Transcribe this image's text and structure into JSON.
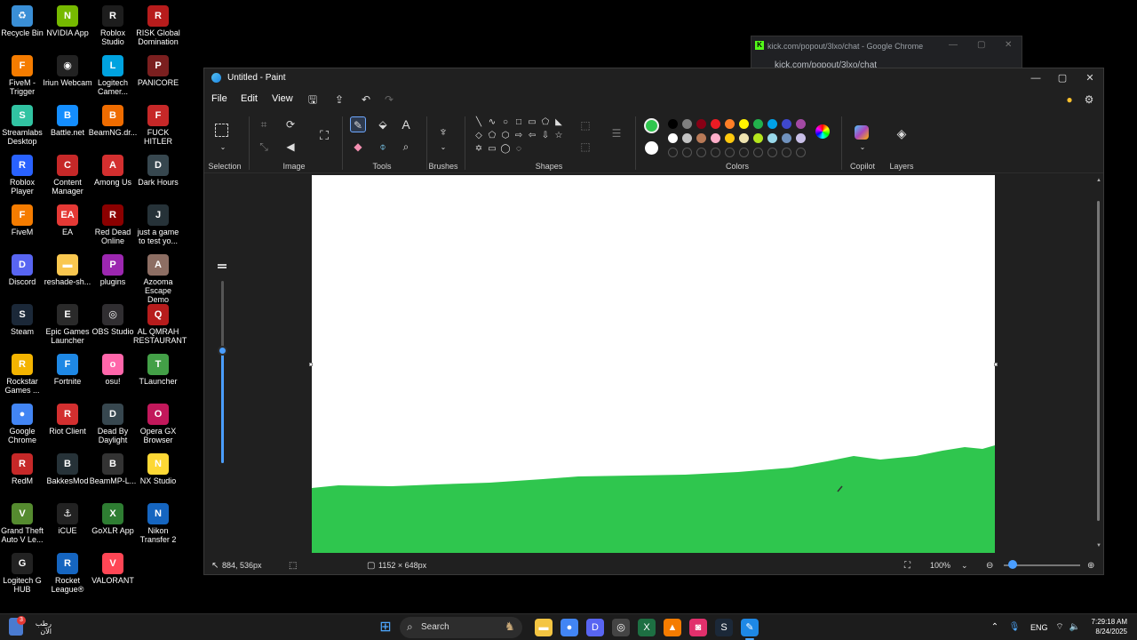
{
  "desktop": {
    "icons": [
      {
        "label": "Recycle Bin",
        "color": "#3a8fd6",
        "glyph": "♻"
      },
      {
        "label": "NVIDIA App",
        "color": "#76b900",
        "glyph": "N"
      },
      {
        "label": "Roblox Studio",
        "color": "#1d1d1d",
        "glyph": "R"
      },
      {
        "label": "RISK Global Domination",
        "color": "#b71c1c",
        "glyph": "R"
      },
      {
        "label": "FiveM - Trigger",
        "color": "#f57c00",
        "glyph": "F"
      },
      {
        "label": "Iriun Webcam",
        "color": "#222",
        "glyph": "◉"
      },
      {
        "label": "Logitech Camer...",
        "color": "#00a3e0",
        "glyph": "L"
      },
      {
        "label": "PANICORE",
        "color": "#7b1f1f",
        "glyph": "P"
      },
      {
        "label": "Streamlabs Desktop",
        "color": "#31c3a2",
        "glyph": "S"
      },
      {
        "label": "Battle.net",
        "color": "#148eff",
        "glyph": "B"
      },
      {
        "label": "BeamNG.dr...",
        "color": "#ef6c00",
        "glyph": "B"
      },
      {
        "label": "FUCK HITLER",
        "color": "#c62828",
        "glyph": "F"
      },
      {
        "label": "Roblox Player",
        "color": "#2962ff",
        "glyph": "R"
      },
      {
        "label": "Content Manager",
        "color": "#c62828",
        "glyph": "C"
      },
      {
        "label": "Among Us",
        "color": "#d32f2f",
        "glyph": "A"
      },
      {
        "label": "Dark Hours",
        "color": "#37474f",
        "glyph": "D"
      },
      {
        "label": "FiveM",
        "color": "#f57c00",
        "glyph": "F"
      },
      {
        "label": "EA",
        "color": "#e53935",
        "glyph": "EA"
      },
      {
        "label": "Red Dead Online",
        "color": "#8b0000",
        "glyph": "R"
      },
      {
        "label": "just a game to test yo...",
        "color": "#263238",
        "glyph": "J"
      },
      {
        "label": "Discord",
        "color": "#5865f2",
        "glyph": "D"
      },
      {
        "label": "reshade-sh...",
        "color": "#f9c74f",
        "glyph": "▬"
      },
      {
        "label": "plugins",
        "color": "#9c27b0",
        "glyph": "P"
      },
      {
        "label": "Azooma Escape Demo",
        "color": "#8d6e63",
        "glyph": "A"
      },
      {
        "label": "Steam",
        "color": "#1b2838",
        "glyph": "S"
      },
      {
        "label": "Epic Games Launcher",
        "color": "#2a2a2a",
        "glyph": "E"
      },
      {
        "label": "OBS Studio",
        "color": "#302e31",
        "glyph": "◎"
      },
      {
        "label": "AL QMRAH RESTAURANT",
        "color": "#b71c1c",
        "glyph": "Q"
      },
      {
        "label": "Rockstar Games ...",
        "color": "#f4b400",
        "glyph": "R"
      },
      {
        "label": "Fortnite",
        "color": "#1e88e5",
        "glyph": "F"
      },
      {
        "label": "osu!",
        "color": "#ff66aa",
        "glyph": "o"
      },
      {
        "label": "TLauncher",
        "color": "#43a047",
        "glyph": "T"
      },
      {
        "label": "Google Chrome",
        "color": "#4285f4",
        "glyph": "●"
      },
      {
        "label": "Riot Client",
        "color": "#d32f2f",
        "glyph": "R"
      },
      {
        "label": "Dead By Daylight",
        "color": "#37474f",
        "glyph": "D"
      },
      {
        "label": "Opera GX Browser",
        "color": "#c2185b",
        "glyph": "O"
      },
      {
        "label": "RedM",
        "color": "#c62828",
        "glyph": "R"
      },
      {
        "label": "BakkesMod",
        "color": "#263238",
        "glyph": "B"
      },
      {
        "label": "BeamMP-L...",
        "color": "#333",
        "glyph": "B"
      },
      {
        "label": "NX Studio",
        "color": "#fdd835",
        "glyph": "N"
      },
      {
        "label": "Grand Theft Auto V Le...",
        "color": "#558b2f",
        "glyph": "V"
      },
      {
        "label": "iCUE",
        "color": "#222",
        "glyph": "⚓"
      },
      {
        "label": "GoXLR App",
        "color": "#2e7d32",
        "glyph": "X"
      },
      {
        "label": "Nikon Transfer 2",
        "color": "#1565c0",
        "glyph": "N"
      },
      {
        "label": "Logitech G HUB",
        "color": "#222",
        "glyph": "G"
      },
      {
        "label": "Rocket League®",
        "color": "#1565c0",
        "glyph": "R"
      },
      {
        "label": "VALORANT",
        "color": "#ff4655",
        "glyph": "V"
      }
    ]
  },
  "chrome_window": {
    "title": "kick.com/popout/3lxo/chat - Google Chrome",
    "url": "kick.com/popout/3lxo/chat",
    "favicon": "K",
    "controls": {
      "minimize": "—",
      "maximize": "▢",
      "close": "✕"
    }
  },
  "paint": {
    "title": "Untitled - Paint",
    "window_controls": {
      "minimize": "—",
      "maximize": "▢",
      "close": "✕"
    },
    "menus": [
      "File",
      "Edit",
      "View"
    ],
    "groups": {
      "selection": "Selection",
      "image": "Image",
      "tools": "Tools",
      "brushes": "Brushes",
      "shapes": "Shapes",
      "colors": "Colors",
      "copilot": "Copilot",
      "layers": "Layers"
    },
    "primary_color": "#2fc64e",
    "secondary_color": "#ffffff",
    "palette_row1": [
      "#000000",
      "#7f7f7f",
      "#880015",
      "#ed1c24",
      "#ff7f27",
      "#fff200",
      "#22b14c",
      "#00a2e8",
      "#3f48cc",
      "#a349a4"
    ],
    "palette_row2": [
      "#ffffff",
      "#c3c3c3",
      "#b97a57",
      "#ffaec9",
      "#ffc90e",
      "#efe4b0",
      "#b5e61d",
      "#99d9ea",
      "#7092be",
      "#c8bfe7"
    ],
    "shape_glyphs": [
      "╲",
      "∿",
      "○",
      "□",
      "▭",
      "⬠",
      "◣",
      "◇",
      "⬠",
      "⬡",
      "⇨",
      "⇦",
      "⇩",
      "☆",
      "✡",
      "▭",
      "◯",
      "◌"
    ],
    "brush_size_fraction": 0.62,
    "fill_color": "#2fc64e",
    "status": {
      "cursor": "884, 536px",
      "canvas_size": "1152 × 648px",
      "zoom": "100%",
      "zoom_level_fraction": 0.12
    }
  },
  "taskbar": {
    "weather_text": "رطب الآن",
    "search": "Search",
    "language": "ENG",
    "time": "7:29:18 AM",
    "date": "8/24/2025",
    "badge": "3",
    "apps": [
      {
        "name": "file-explorer",
        "color": "#f4c542",
        "glyph": "▬"
      },
      {
        "name": "chrome",
        "color": "#4285f4",
        "glyph": "●"
      },
      {
        "name": "discord",
        "color": "#5865f2",
        "glyph": "D"
      },
      {
        "name": "steam-alt",
        "color": "#444",
        "glyph": "◎"
      },
      {
        "name": "excel",
        "color": "#1d6f42",
        "glyph": "X"
      },
      {
        "name": "vlc",
        "color": "#f57c00",
        "glyph": "▲"
      },
      {
        "name": "instagram",
        "color": "#e1306c",
        "glyph": "◙"
      },
      {
        "name": "steam",
        "color": "#1b2838",
        "glyph": "S"
      },
      {
        "name": "paint",
        "color": "#1e88e5",
        "glyph": "✎"
      }
    ]
  }
}
